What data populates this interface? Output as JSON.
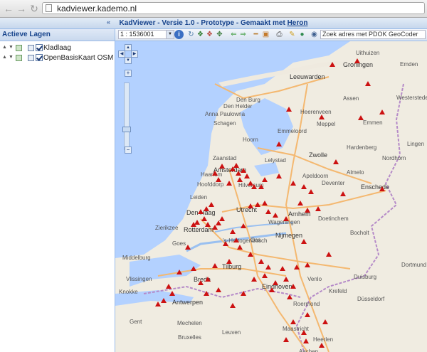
{
  "browser": {
    "url": "kadviewer.kademo.nl"
  },
  "header": {
    "title_prefix": "KadViewer - Versie 1.0 - Prototype - Gemaakt met ",
    "title_link": "Heron"
  },
  "layers_panel": {
    "title": "Actieve Lagen",
    "items": [
      {
        "label": "Kladlaag",
        "checked": true
      },
      {
        "label": "OpenBasisKaart OSM",
        "checked": true
      }
    ]
  },
  "toolbar": {
    "scale_value": "1 : 1536001",
    "search_placeholder": "Zoek adres met PDOK GeoCoder",
    "icons": [
      "info-icon",
      "pan-icon",
      "zoom-in-tool-icon",
      "zoom-out-tool-icon",
      "zoom-extent-icon",
      "back-arrow-icon",
      "forward-arrow-icon",
      "measure-length-icon",
      "measure-area-icon",
      "print-icon",
      "globe-icon",
      "edit-icon",
      "globe-search-icon",
      "binoculars-icon"
    ]
  },
  "map": {
    "place_labels": [
      "Uithuizen",
      "Groningen",
      "Emden",
      "Leeuwarden",
      "Den Burg",
      "Assen",
      "Den Helder",
      "Heerenveen",
      "Anna Paulowna",
      "Emmen",
      "Schagen",
      "Meppel",
      "Hoorn",
      "Emmeloord",
      "Lelystad",
      "Zwolle",
      "Hardenberg",
      "Zaanstad",
      "Amsterdam",
      "Hoofddorp",
      "Hilversum",
      "Almelo",
      "Deventer",
      "Enschede",
      "Den Haag",
      "Utrecht",
      "Apeldoorn",
      "Arnhem",
      "Nijmegen",
      "Zierikzee",
      "Goes",
      "Middelburg",
      "Vlissingen",
      "'s-Hertogenbosch",
      "Tilburg",
      "Breda",
      "Eindhoven",
      "Venlo",
      "Duisburg",
      "Dortmund",
      "Antwerpen",
      "Düsseldorf",
      "Krefeld",
      "Mechelen",
      "Leuven",
      "Aachen",
      "Heerlen",
      "Bruxelles",
      "Maastricht",
      "Roermond",
      "Doetinchem",
      "Bocholt",
      "Oss",
      "Gent",
      "Knokke",
      "Nordhorn",
      "Lingen",
      "Westerstede",
      "Rotterdam",
      "Haarlem",
      "Leiden",
      "Wageningen"
    ]
  }
}
